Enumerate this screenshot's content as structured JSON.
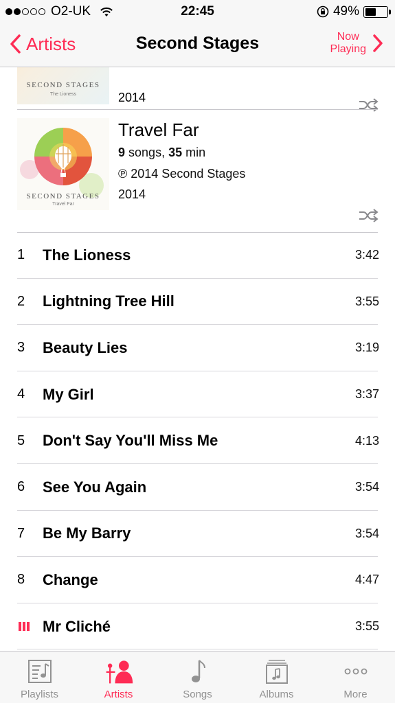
{
  "status_bar": {
    "carrier": "O2-UK",
    "time": "22:45",
    "battery": "49%",
    "battery_level": 0.49,
    "signal_bars_filled": 2,
    "signal_bars_total": 5
  },
  "nav": {
    "back_label": "Artists",
    "title": "Second Stages",
    "now_playing_line1": "Now",
    "now_playing_line2": "Playing"
  },
  "previous_album": {
    "year": "2014",
    "art_text": "SECOND STAGES",
    "art_subtext": "The Lioness"
  },
  "album": {
    "title": "Travel Far",
    "song_count": "9",
    "songs_word": "songs,",
    "duration": "35",
    "duration_unit": "min",
    "copyright": "℗ 2014 Second Stages",
    "year": "2014",
    "art_text": "SECOND STAGES",
    "art_subtext": "Travel Far"
  },
  "tracks": [
    {
      "num": "1",
      "name": "The Lioness",
      "duration": "3:42"
    },
    {
      "num": "2",
      "name": "Lightning Tree Hill",
      "duration": "3:55"
    },
    {
      "num": "3",
      "name": "Beauty Lies",
      "duration": "3:19"
    },
    {
      "num": "4",
      "name": "My Girl",
      "duration": "3:37"
    },
    {
      "num": "5",
      "name": "Don't Say You'll Miss Me",
      "duration": "4:13"
    },
    {
      "num": "6",
      "name": "See You Again",
      "duration": "3:54"
    },
    {
      "num": "7",
      "name": "Be My Barry",
      "duration": "3:54"
    },
    {
      "num": "8",
      "name": "Change",
      "duration": "4:47"
    },
    {
      "num": "",
      "name": "Mr Cliché",
      "duration": "3:55",
      "playing": true
    }
  ],
  "tabs": [
    {
      "label": "Playlists",
      "icon": "playlists-icon"
    },
    {
      "label": "Artists",
      "icon": "artists-icon",
      "active": true
    },
    {
      "label": "Songs",
      "icon": "songs-icon"
    },
    {
      "label": "Albums",
      "icon": "albums-icon"
    },
    {
      "label": "More",
      "icon": "more-icon"
    }
  ],
  "colors": {
    "accent": "#fe2c55",
    "tab_inactive": "#929292",
    "bar_background": "#f7f7f7",
    "divider": "#c8c7cc"
  }
}
